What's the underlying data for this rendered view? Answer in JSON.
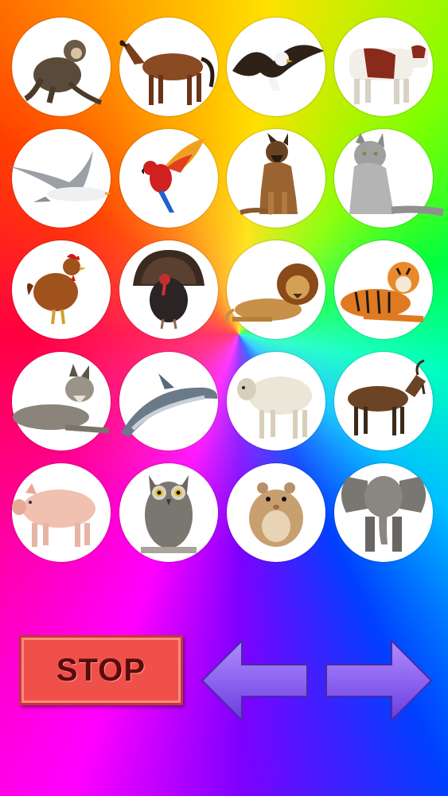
{
  "animals": [
    {
      "name": "monkey-icon"
    },
    {
      "name": "horse-icon"
    },
    {
      "name": "eagle-icon"
    },
    {
      "name": "cow-icon"
    },
    {
      "name": "seagull-icon"
    },
    {
      "name": "parrot-icon"
    },
    {
      "name": "dog-icon"
    },
    {
      "name": "cat-icon"
    },
    {
      "name": "chicken-icon"
    },
    {
      "name": "turkey-icon"
    },
    {
      "name": "lion-icon"
    },
    {
      "name": "tiger-icon"
    },
    {
      "name": "wolf-icon"
    },
    {
      "name": "dolphin-icon"
    },
    {
      "name": "sheep-icon"
    },
    {
      "name": "goat-icon"
    },
    {
      "name": "pig-icon"
    },
    {
      "name": "owl-icon"
    },
    {
      "name": "hamster-icon"
    },
    {
      "name": "elephant-icon"
    }
  ],
  "controls": {
    "stop_label": "STOP",
    "back_icon": "left-arrow-icon",
    "forward_icon": "right-arrow-icon"
  },
  "colors": {
    "stop_button": "#f0504a",
    "stop_text": "#5a0c0c",
    "arrow": "#8a5cf0"
  }
}
